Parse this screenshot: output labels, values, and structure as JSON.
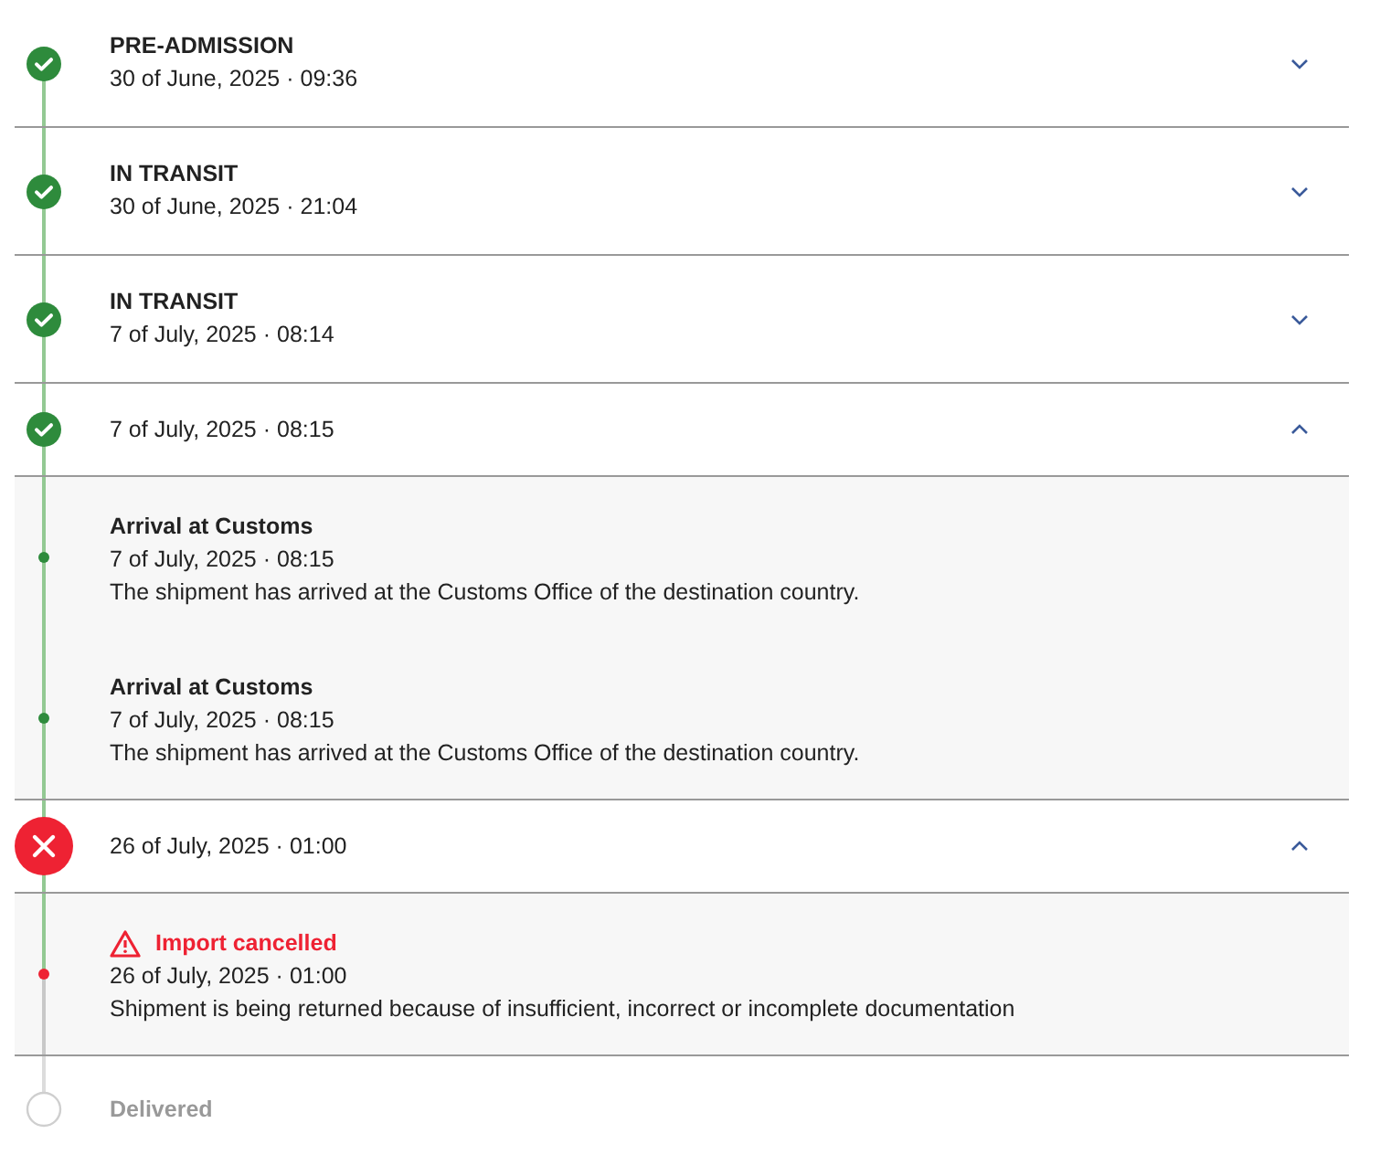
{
  "steps": [
    {
      "kind": "done",
      "title": "PRE-ADMISSION",
      "date": "30 of June, 2025 · 09:36",
      "expanded": false
    },
    {
      "kind": "done",
      "title": "IN TRANSIT",
      "date": "30 of June, 2025 · 21:04",
      "expanded": false
    },
    {
      "kind": "done",
      "title": "IN TRANSIT",
      "date": "7 of July, 2025 · 08:14",
      "expanded": false
    },
    {
      "kind": "done",
      "date": "7 of July, 2025 · 08:15",
      "expanded": true,
      "events": [
        {
          "kind": "info",
          "title": "Arrival at Customs",
          "date": "7 of July, 2025 · 08:15",
          "description": "The shipment has arrived at the Customs Office of the destination country."
        },
        {
          "kind": "info",
          "title": "Arrival at Customs",
          "date": "7 of July, 2025 · 08:15",
          "description": "The shipment has arrived at the Customs Office of the destination country."
        }
      ]
    },
    {
      "kind": "failed",
      "date": "26 of July, 2025 · 01:00",
      "expanded": true,
      "events": [
        {
          "kind": "alert",
          "title": "Import cancelled",
          "date": "26 of July, 2025 · 01:00",
          "description": "Shipment is being returned because of insufficient, incorrect or incomplete documentation"
        }
      ]
    },
    {
      "kind": "pending",
      "title": "Delivered"
    }
  ]
}
